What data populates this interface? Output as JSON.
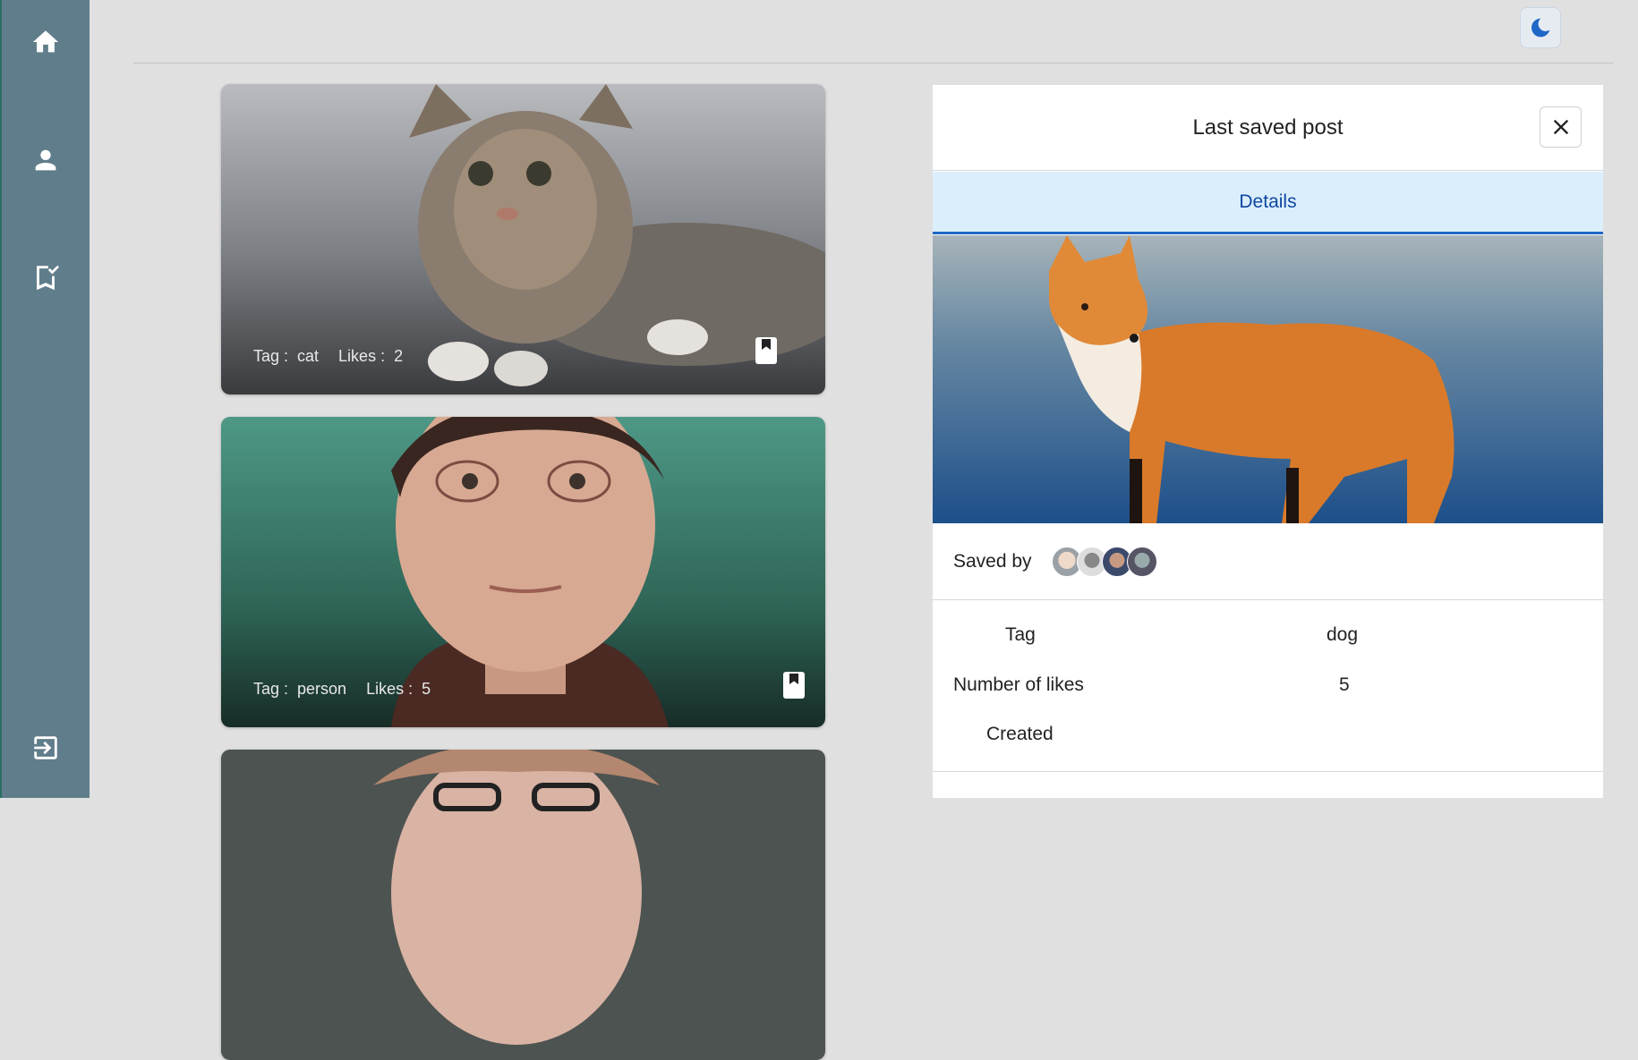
{
  "sidebar": {
    "items": [
      {
        "name": "home",
        "icon": "home-icon"
      },
      {
        "name": "profile",
        "icon": "person-icon"
      },
      {
        "name": "saved",
        "icon": "bookmark-check-icon"
      }
    ],
    "logout_icon": "logout-icon"
  },
  "header": {
    "theme_icon": "moon-icon"
  },
  "feed": {
    "posts": [
      {
        "tag_label": "Tag :",
        "tag": "cat",
        "likes_label": "Likes :",
        "likes": "2",
        "image": "kitten"
      },
      {
        "tag_label": "Tag :",
        "tag": "person",
        "likes_label": "Likes :",
        "likes": "5",
        "image": "young man with glasses"
      },
      {
        "image": "woman with glasses (partially visible)"
      }
    ]
  },
  "panel": {
    "title": "Last saved post",
    "tab": "Details",
    "image": "red fox",
    "saved_by_label": "Saved by",
    "avatars_count": 4,
    "details": [
      {
        "key": "Tag",
        "value": "dog"
      },
      {
        "key": "Number of likes",
        "value": "5"
      },
      {
        "key": "Created",
        "value": ""
      }
    ]
  },
  "colors": {
    "sidebar": "#607d8b",
    "accent": "#1f67c7",
    "tab_bg": "#dbeefc",
    "page_bg": "#e0e0e0"
  }
}
